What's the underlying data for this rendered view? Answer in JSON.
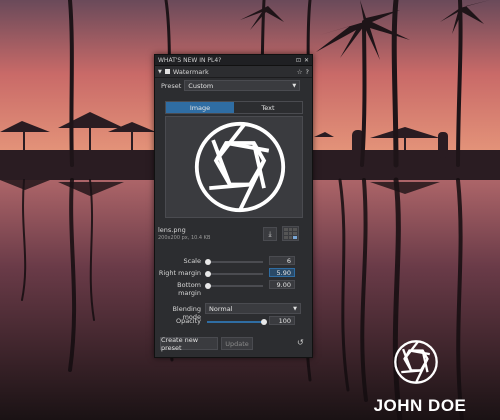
{
  "panel": {
    "title": "WHAT'S NEW IN PL4?",
    "section_title": "Watermark",
    "preset_label": "Preset",
    "preset_value": "Custom",
    "tabs": [
      {
        "label": "Image",
        "active": true
      },
      {
        "label": "Text",
        "active": false
      }
    ],
    "file_name": "lens.png",
    "file_meta": "200x200 px, 10.4 KB",
    "scale": {
      "label": "Scale",
      "value": "6",
      "level": 0.0
    },
    "right_margin": {
      "label": "Right margin",
      "value": "5.90",
      "level": 0.95
    },
    "bottom_margin": {
      "label": "Bottom margin",
      "value": "9.00",
      "level": 0.95
    },
    "blending_label": "Blending mode",
    "blending_value": "Normal",
    "opacity": {
      "label": "Opacity",
      "value": "100",
      "level": 1.0
    },
    "create_preset_label": "Create new preset",
    "update_label": "Update"
  },
  "overlay_brand": "JOHN DOE",
  "colors": {
    "accent": "#2f6da3",
    "panel_bg": "#2c2d30"
  }
}
